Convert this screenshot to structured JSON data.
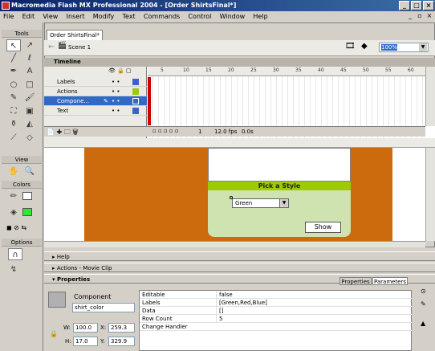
{
  "window": {
    "title": "Macromedia Flash MX Professional 2004 - [Order ShirtsFinal*]",
    "min": "_",
    "max": "□",
    "close": "×"
  },
  "menu": [
    "File",
    "Edit",
    "View",
    "Insert",
    "Modify",
    "Text",
    "Commands",
    "Control",
    "Window",
    "Help"
  ],
  "tools": {
    "title": "Tools",
    "view": "View",
    "colors": "Colors",
    "options": "Options"
  },
  "document": {
    "tab": "Order ShirtsFinal*",
    "scene": "Scene 1",
    "zoom": "100%"
  },
  "timeline": {
    "title": "Timeline",
    "layers": [
      "Labels",
      "Actions",
      "Compone...",
      "Text"
    ],
    "ruler": [
      "5",
      "10",
      "15",
      "20",
      "25",
      "30",
      "35",
      "40",
      "45",
      "50",
      "55",
      "60"
    ],
    "frame": "1",
    "fps": "12.0 fps",
    "time": "0.0s"
  },
  "stage": {
    "heading": "Pick a Style",
    "combo_value": "Green",
    "button": "Show"
  },
  "panels": {
    "help": "Help",
    "actions": "Actions - Movie Clip",
    "properties": "Properties",
    "tab_properties": "Properties",
    "tab_parameters": "Parameters"
  },
  "props": {
    "kind": "Component",
    "instance": "shirt_color",
    "w_label": "W:",
    "w": "100.0",
    "x_label": "X:",
    "x": "259.3",
    "h_label": "H:",
    "h": "17.0",
    "y_label": "Y:",
    "y": "329.9",
    "rows": [
      {
        "k": "Editable",
        "v": "false"
      },
      {
        "k": "Labels",
        "v": "[Green,Red,Blue]"
      },
      {
        "k": "Data",
        "v": "[]"
      },
      {
        "k": "Row Count",
        "v": "5"
      },
      {
        "k": "Change Handler",
        "v": ""
      }
    ]
  },
  "colors": {
    "title_bar": "#0a246a",
    "stage_bg": "#cc6b0e",
    "style_bar": "#9ccc00",
    "style_panel": "#cee3b0",
    "fill": "#2ee82e"
  }
}
